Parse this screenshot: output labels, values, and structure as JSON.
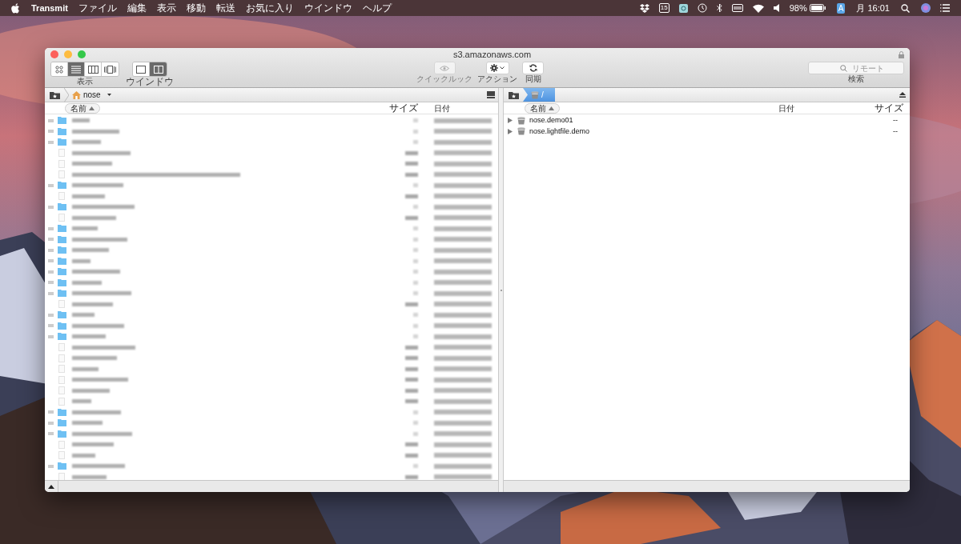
{
  "menubar": {
    "app": "Transmit",
    "menus": [
      "ファイル",
      "編集",
      "表示",
      "移動",
      "転送",
      "お気に入り",
      "ウインドウ",
      "ヘルプ"
    ],
    "calendar_day": "15",
    "battery": "98%",
    "input_source": "A",
    "clock": "月 16:01"
  },
  "window": {
    "title": "s3.amazonaws.com",
    "toolbar": {
      "view_modes": [
        {
          "kind": "icons",
          "selected": false
        },
        {
          "kind": "list",
          "selected": true
        },
        {
          "kind": "columns",
          "selected": false
        },
        {
          "kind": "coverflow",
          "selected": false
        }
      ],
      "view_label": "表示",
      "window_modes": [
        {
          "kind": "single",
          "selected": false
        },
        {
          "kind": "dual",
          "selected": true
        }
      ],
      "window_label": "ウインドウ",
      "quicklook": {
        "label": "クイックルック",
        "disabled": true
      },
      "action_label": "アクション",
      "sync_label": "同期",
      "search": {
        "placeholder": "リモート",
        "label": "検索"
      }
    },
    "left_pane": {
      "path": "nose",
      "columns": [
        "名前",
        "サイズ",
        "日付"
      ],
      "rows": [
        {
          "kind": "folder"
        },
        {
          "kind": "folder"
        },
        {
          "kind": "folder"
        },
        {
          "kind": "file"
        },
        {
          "kind": "file"
        },
        {
          "kind": "file"
        },
        {
          "kind": "folder"
        },
        {
          "kind": "file"
        },
        {
          "kind": "folder"
        },
        {
          "kind": "file"
        },
        {
          "kind": "folder"
        },
        {
          "kind": "folder"
        },
        {
          "kind": "folder"
        },
        {
          "kind": "folder"
        },
        {
          "kind": "folder"
        },
        {
          "kind": "folder"
        },
        {
          "kind": "folder"
        },
        {
          "kind": "file"
        },
        {
          "kind": "folder"
        },
        {
          "kind": "folder"
        },
        {
          "kind": "folder"
        },
        {
          "kind": "file"
        },
        {
          "kind": "file"
        },
        {
          "kind": "file"
        },
        {
          "kind": "file"
        },
        {
          "kind": "file"
        },
        {
          "kind": "file"
        },
        {
          "kind": "folder"
        },
        {
          "kind": "folder"
        },
        {
          "kind": "folder"
        },
        {
          "kind": "file"
        },
        {
          "kind": "file"
        },
        {
          "kind": "folder"
        },
        {
          "kind": "file"
        }
      ]
    },
    "right_pane": {
      "path": "/",
      "columns": [
        "名前",
        "日付",
        "サイズ"
      ],
      "rows": [
        {
          "name": "nose.demo01",
          "size": "--"
        },
        {
          "name": "nose.lightfile.demo",
          "size": "--"
        }
      ]
    }
  }
}
